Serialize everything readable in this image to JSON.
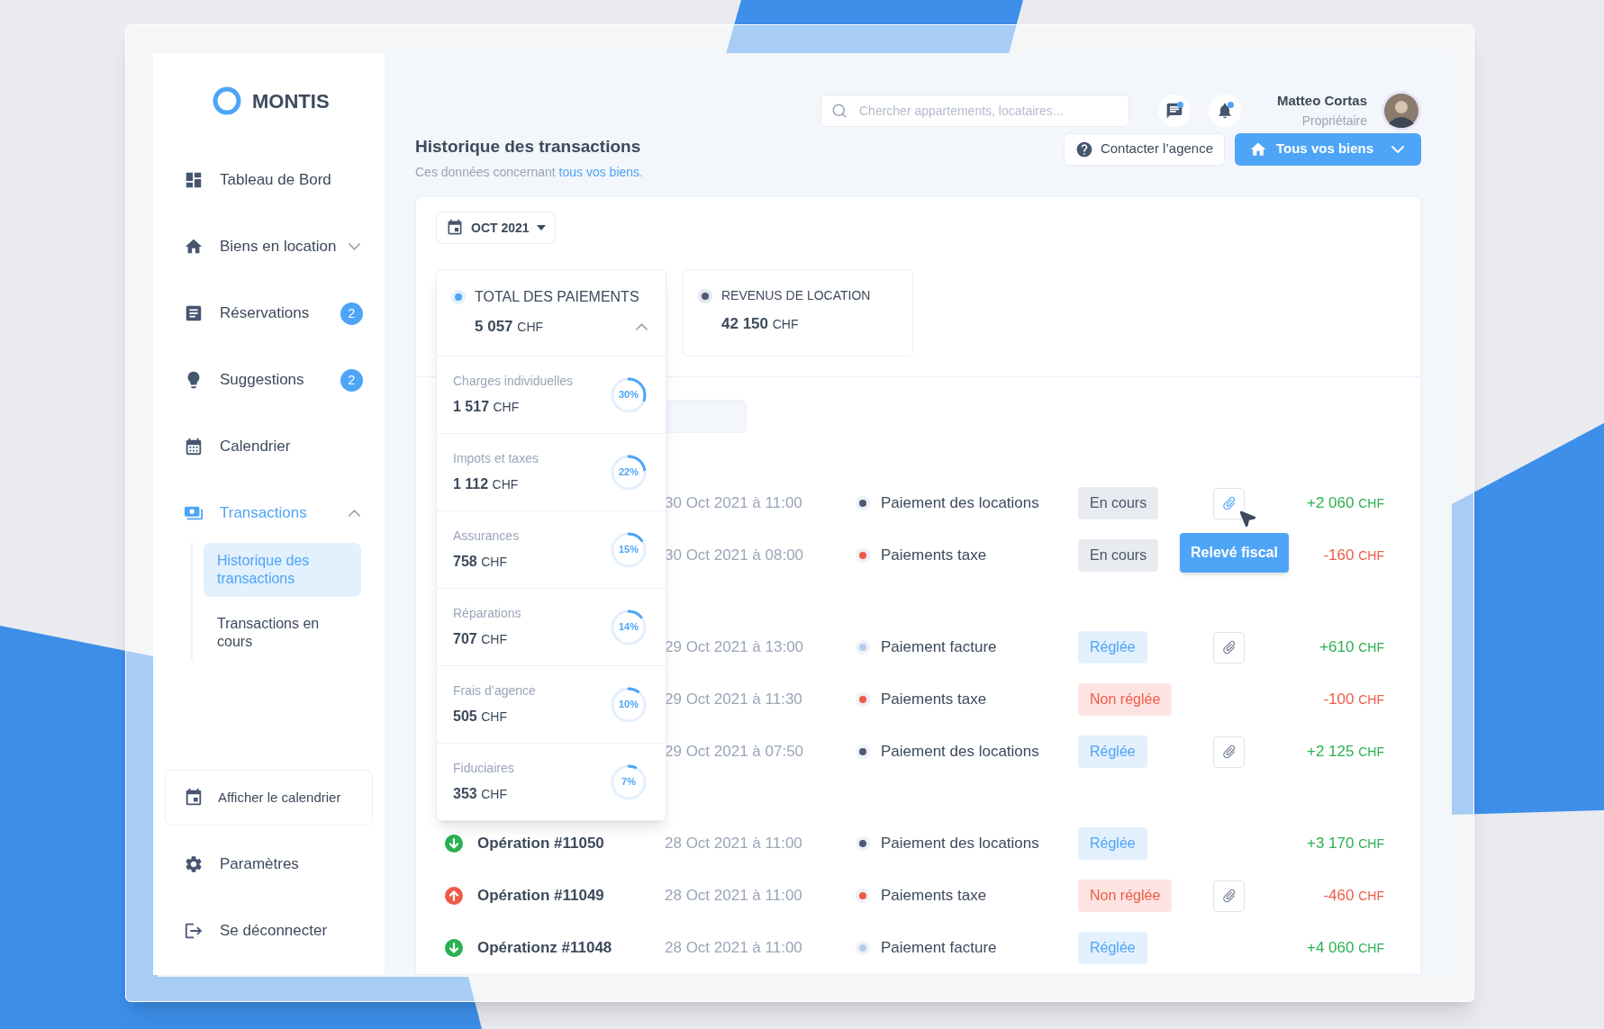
{
  "brand": {
    "name": "MONTIS"
  },
  "nav": [
    {
      "label": "Tableau de Bord",
      "selected": false
    },
    {
      "label": "Biens en location",
      "selected": false,
      "expanded": false
    },
    {
      "label": "Réservations",
      "badge": "2",
      "selected": false
    },
    {
      "label": "Suggestions",
      "badge": "2",
      "selected": false
    },
    {
      "label": "Calendrier",
      "selected": false
    },
    {
      "label": "Transactions",
      "selected": true,
      "expanded": true,
      "children": [
        {
          "label": "Historique des transactions",
          "selected": true
        },
        {
          "label": "Transactions en cours",
          "selected": false
        }
      ]
    }
  ],
  "calendar_button": "Afficher le calendrier",
  "bottom_nav": [
    {
      "label": "Paramètres"
    },
    {
      "label": "Se déconnecter"
    }
  ],
  "search": {
    "placeholder": "Chercher appartements, locataires..."
  },
  "header_icons": [
    {
      "unread": true
    },
    {
      "unread": true
    }
  ],
  "user": {
    "name": "Matteo Cortas",
    "role": "Propriétaire"
  },
  "page": {
    "title": "Historique des transactions",
    "subtitle": "Ces données concernant",
    "subtitle_link": "tous vos biens",
    "subtitle_end": "."
  },
  "contact_button": "Contacter l’agence",
  "property_select": "Tous vos biens",
  "month_picker": "OCT 2021",
  "summary_cards": [
    {
      "label": "TOTAL DES PAIEMENTS",
      "amount": "5 057",
      "currency": "CHF",
      "selected": true,
      "expanded": true,
      "breakdown": [
        {
          "label": "Charges individuelles",
          "amount": "1 517",
          "currency": "CHF",
          "percent": "30%",
          "level": 0.3
        },
        {
          "label": "Impots et taxes",
          "amount": "1 112",
          "currency": "CHF",
          "percent": "22%",
          "level": 0.22
        },
        {
          "label": "Assurances",
          "amount": "758",
          "currency": "CHF",
          "percent": "15%",
          "level": 0.15
        },
        {
          "label": "Réparations",
          "amount": "707",
          "currency": "CHF",
          "percent": "14%",
          "level": 0.14
        },
        {
          "label": "Frais d’agence",
          "amount": "505",
          "currency": "CHF",
          "percent": "10%",
          "level": 0.1
        },
        {
          "label": "Fiduciaires",
          "amount": "353",
          "currency": "CHF",
          "percent": "7%",
          "level": 0.07
        }
      ]
    },
    {
      "label": "REVENUS DE LOCATION",
      "amount": "42 150",
      "currency": "CHF",
      "selected": false,
      "expanded": false
    }
  ],
  "groups": [
    {
      "rows": [
        {
          "credit": true,
          "date": "30 Oct 2021 à 11:00",
          "type": "Paiement des locations",
          "color": "#4a5a78",
          "status": {
            "label": "En cours",
            "kind": "pending"
          },
          "attachment": true,
          "tooltip": "Relevé fiscal",
          "amount": "+2 060",
          "currency": "CHF"
        },
        {
          "credit": false,
          "date": "30 Oct 2021 à 08:00",
          "type": "Paiements taxe",
          "color": "#ef5a47",
          "status": {
            "label": "En cours",
            "kind": "pending"
          },
          "attachment": false,
          "amount": "-160",
          "currency": "CHF"
        }
      ]
    },
    {
      "rows": [
        {
          "credit": true,
          "date": "29 Oct 2021 à 13:00",
          "type": "Paiement facture",
          "color": "#b8cdee",
          "status": {
            "label": "Réglée",
            "kind": "paid"
          },
          "attachment": true,
          "amount": "+610",
          "currency": "CHF"
        },
        {
          "credit": false,
          "date": "29 Oct 2021 à 11:30",
          "type": "Paiements taxe",
          "color": "#ef5a47",
          "status": {
            "label": "Non réglée",
            "kind": "unpaid"
          },
          "attachment": false,
          "amount": "-100",
          "currency": "CHF"
        },
        {
          "credit": true,
          "date": "29 Oct 2021 à 07:50",
          "type": "Paiement des locations",
          "color": "#4a5a78",
          "status": {
            "label": "Réglée",
            "kind": "paid"
          },
          "attachment": true,
          "amount": "+2 125",
          "currency": "CHF"
        }
      ]
    },
    {
      "rows": [
        {
          "credit": true,
          "operation": "Opération #11050",
          "date": "28 Oct 2021 à 11:00",
          "type": "Paiement des locations",
          "color": "#4a5a78",
          "status": {
            "label": "Réglée",
            "kind": "paid"
          },
          "attachment": false,
          "amount": "+3 170",
          "currency": "CHF"
        },
        {
          "credit": false,
          "operation": "Opération #11049",
          "date": "28 Oct 2021 à 11:00",
          "type": "Paiements taxe",
          "color": "#ef5a47",
          "status": {
            "label": "Non réglée",
            "kind": "unpaid"
          },
          "attachment": true,
          "amount": "-460",
          "currency": "CHF"
        },
        {
          "credit": true,
          "operation": "Opérationz #11048",
          "date": "28 Oct 2021 à 11:00",
          "type": "Paiement facture",
          "color": "#b8cdee",
          "status": {
            "label": "Réglée",
            "kind": "paid"
          },
          "attachment": false,
          "amount": "+4 060",
          "currency": "CHF"
        }
      ]
    }
  ]
}
